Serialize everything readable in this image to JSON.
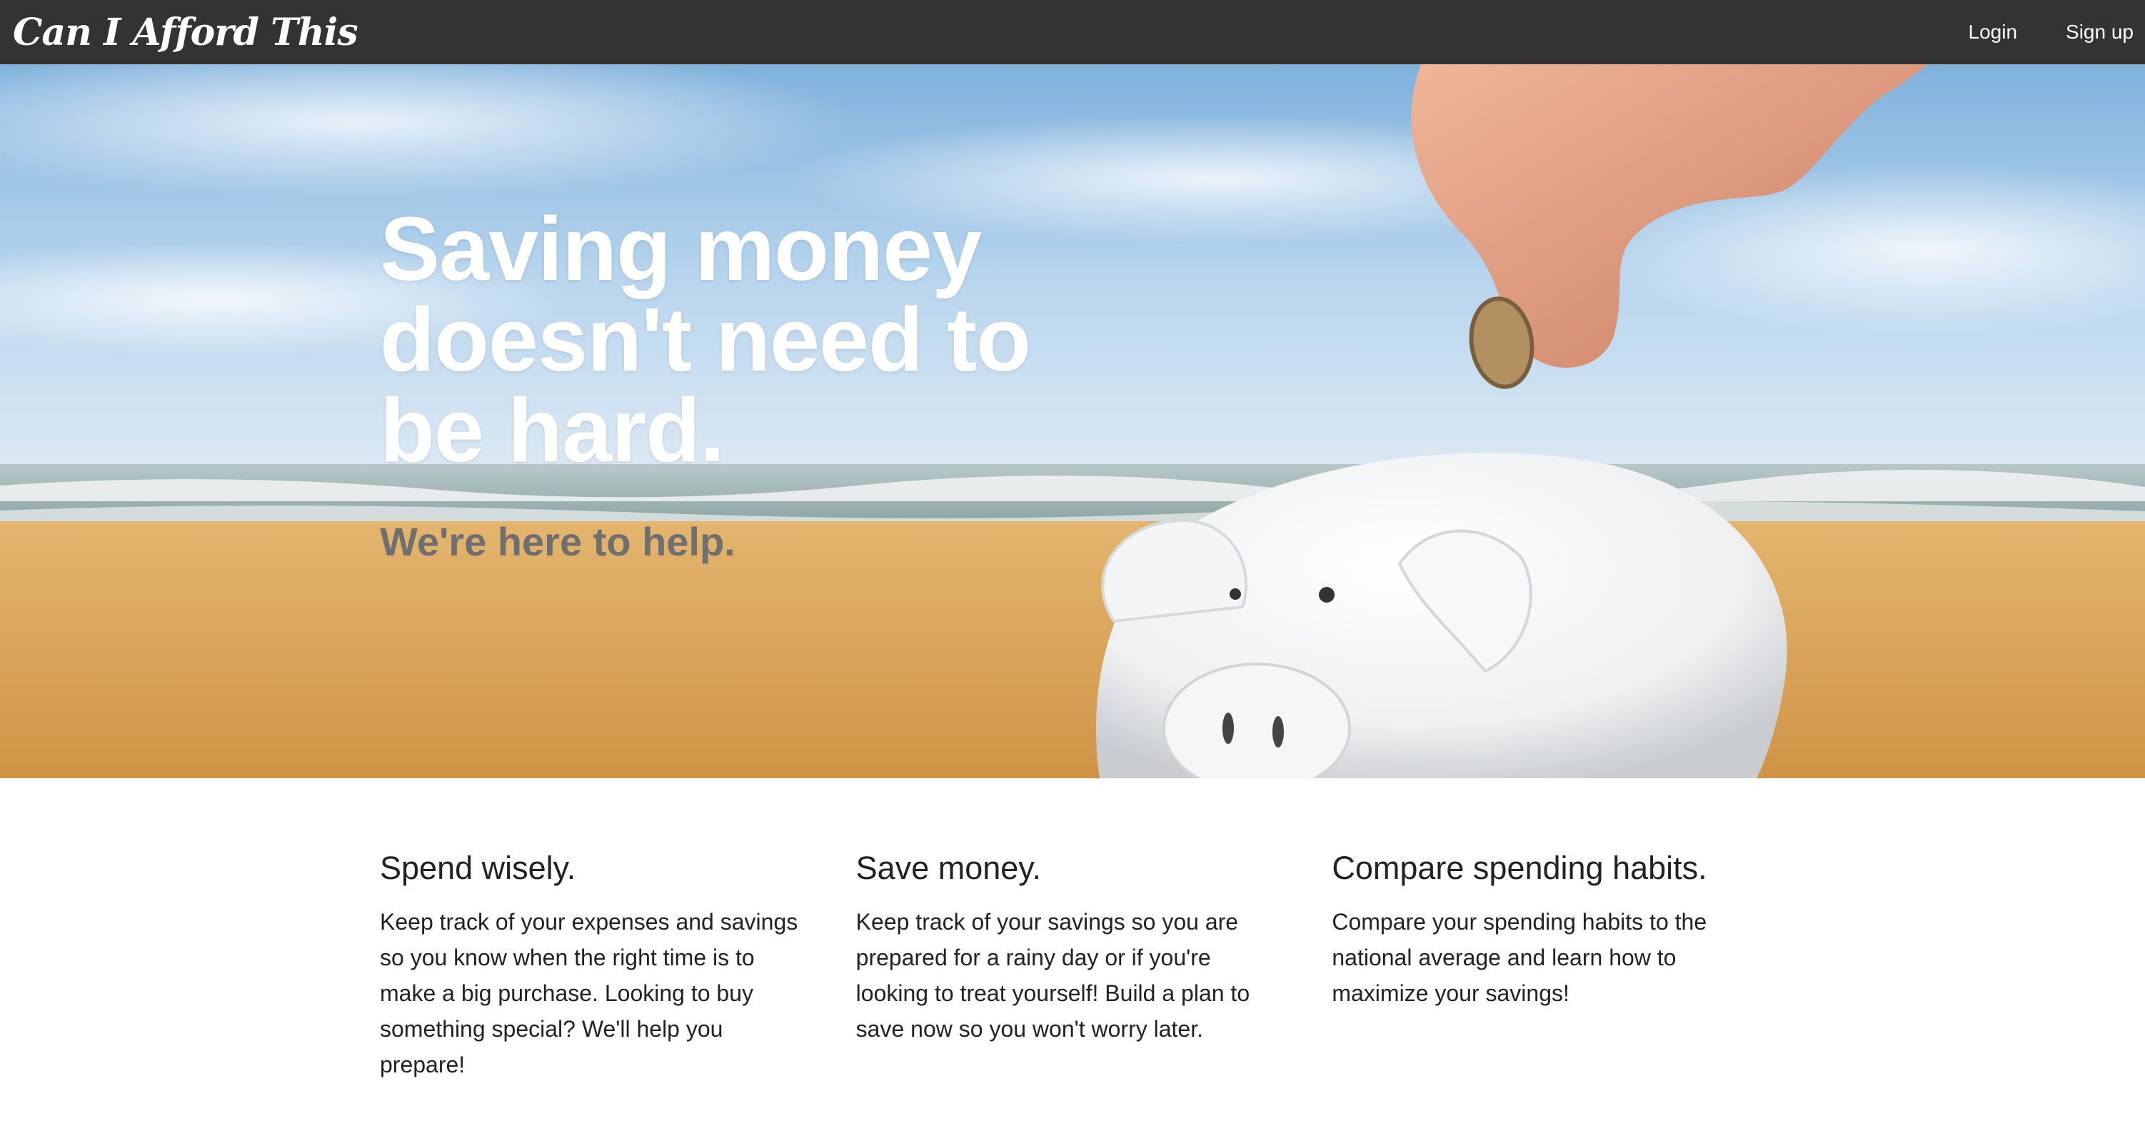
{
  "nav": {
    "brand": "Can I Afford This",
    "links": [
      {
        "label": "Login"
      },
      {
        "label": "Sign up"
      }
    ]
  },
  "hero": {
    "title": "Saving money doesn't need to be hard.",
    "subtitle": "We're here to help.",
    "image": "piggy-bank-beach-photo"
  },
  "features": [
    {
      "heading": "Spend wisely.",
      "body": "Keep track of your expenses and savings so you know when the right time is to make a big purchase. Looking to buy something special? We'll help you prepare!"
    },
    {
      "heading": "Save money.",
      "body": "Keep track of your savings so you are prepared for a rainy day or if you're looking to treat yourself! Build a plan to save now so you won't worry later."
    },
    {
      "heading": "Compare spending habits.",
      "body": "Compare your spending habits to the national average and learn how to maximize your savings!"
    }
  ],
  "colors": {
    "navbar": "#333333",
    "hero_subtitle": "#6f6f6f",
    "sand": "#d9a55a",
    "sky": "#9cc4e6"
  }
}
